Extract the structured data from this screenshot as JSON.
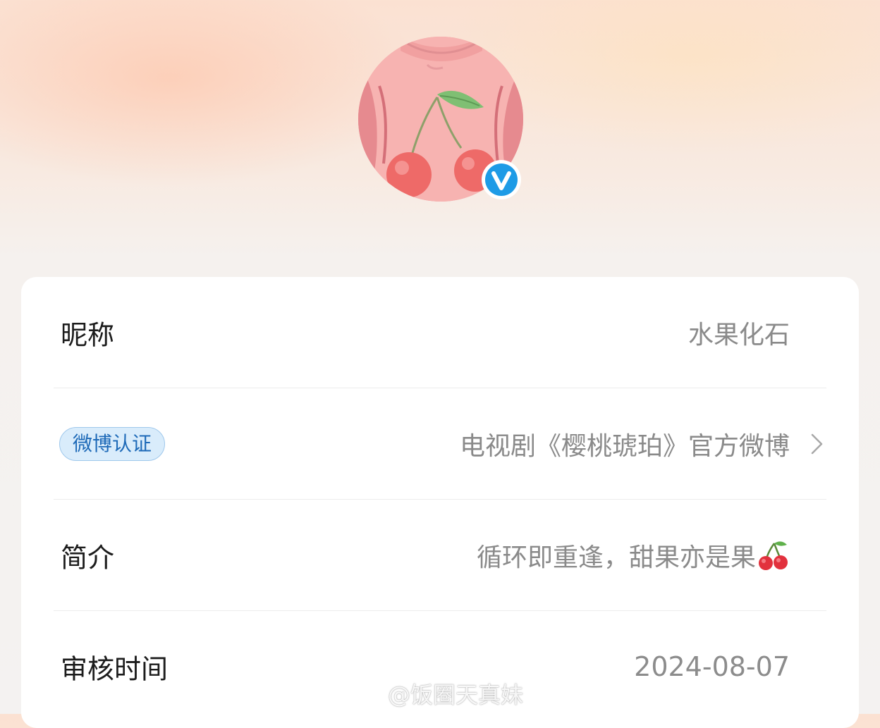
{
  "profile": {
    "avatar": {
      "icon": "cherry-icon",
      "badge_icon": "verified-v-icon",
      "badge_color": "#1e9be6"
    }
  },
  "rows": {
    "nickname": {
      "label": "昵称",
      "value": "水果化石"
    },
    "certification": {
      "badge_label": "微博认证",
      "value": "电视剧《樱桃琥珀》官方微博",
      "chevron_icon": "chevron-right-icon"
    },
    "bio": {
      "label": "简介",
      "value": "循环即重逢，甜果亦是果",
      "emoji_icon": "cherry-emoji-icon"
    },
    "review_time": {
      "label": "审核时间",
      "value": "2024-08-07"
    }
  },
  "watermark": {
    "text": "@饭圈天真妹",
    "icon": "weibo-logo-icon"
  },
  "colors": {
    "badge_bg": "#d9ecfb",
    "badge_text": "#1e6ab8",
    "value_gray": "#8a8a8a",
    "label_dark": "#1c1c1c",
    "verified_blue": "#1e9be6"
  }
}
